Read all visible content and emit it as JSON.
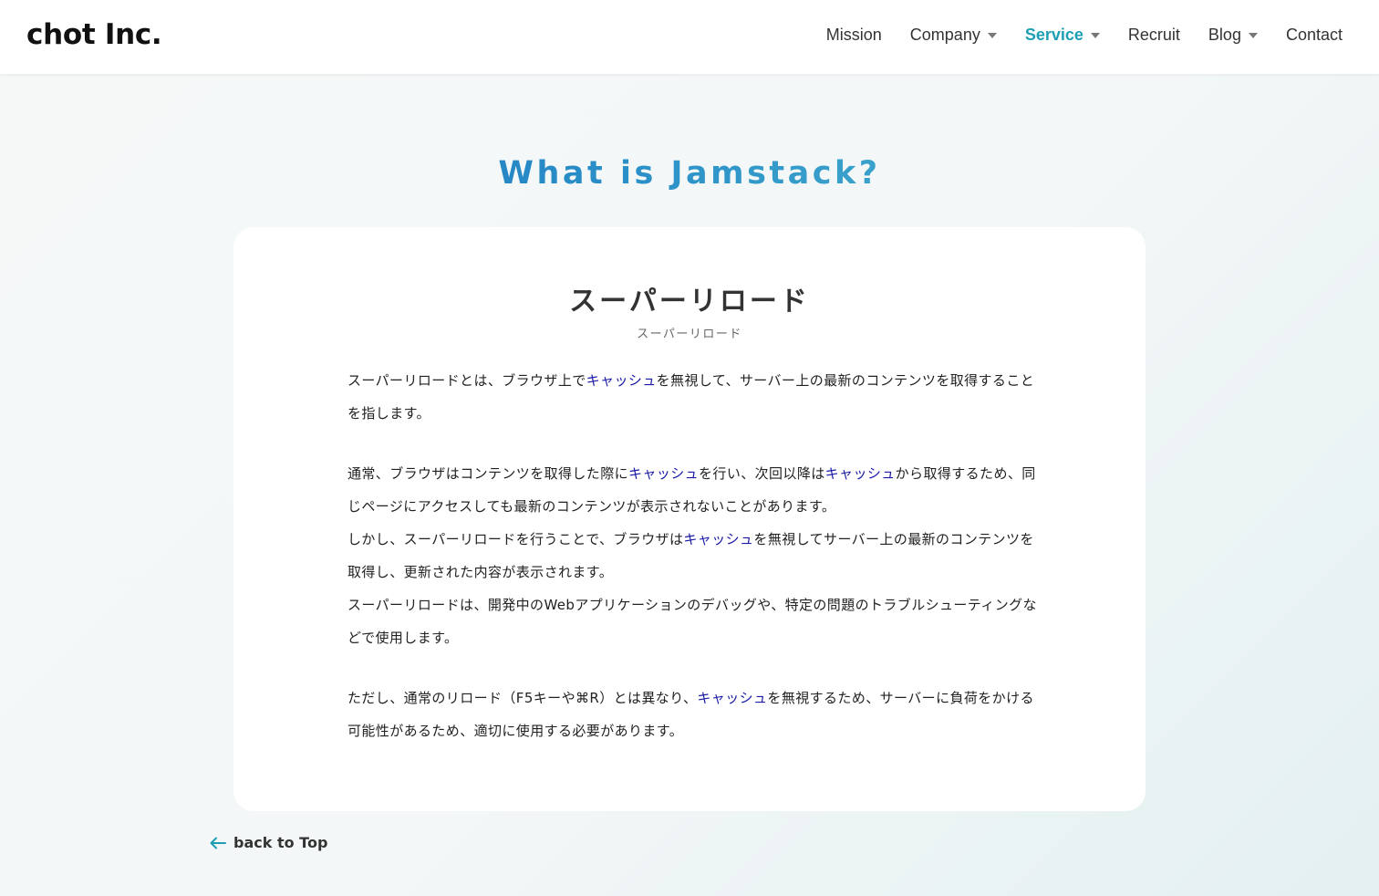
{
  "header": {
    "logo": "chot Inc.",
    "nav": [
      {
        "label": "Mission",
        "dropdown": false
      },
      {
        "label": "Company",
        "dropdown": true
      },
      {
        "label": "Service",
        "dropdown": true,
        "active": true
      },
      {
        "label": "Recruit",
        "dropdown": false
      },
      {
        "label": "Blog",
        "dropdown": true
      },
      {
        "label": "Contact",
        "dropdown": false
      }
    ]
  },
  "section_title": "What is Jamstack?",
  "term": {
    "title": "スーパーリロード",
    "reading": "スーパーリロード"
  },
  "paragraphs": {
    "p1": {
      "a": "スーパーリロードとは、ブラウザ上で",
      "link1": "キャッシュ",
      "b": "を無視して、サーバー上の最新のコンテンツを取得することを指します。"
    },
    "p2": {
      "a": "通常、ブラウザはコンテンツを取得した際に",
      "link1": "キャッシュ",
      "b": "を行い、次回以降は",
      "link2": "キャッシュ",
      "c": "から取得するため、同じページにアクセスしても最新のコンテンツが表示されないことがあります。"
    },
    "p3": {
      "a": "しかし、スーパーリロードを行うことで、ブラウザは",
      "link1": "キャッシュ",
      "b": "を無視してサーバー上の最新のコンテンツを取得し、更新された内容が表示されます。"
    },
    "p4": {
      "a": "スーパーリロードは、開発中のWebアプリケーションのデバッグや、特定の問題のトラブルシューティングなどで使用します。"
    },
    "p5": {
      "a": "ただし、通常のリロード（F5キーや⌘R）とは異なり、",
      "link1": "キャッシュ",
      "b": "を無視するため、サーバーに負荷をかける可能性があるため、適切に使用する必要があります。"
    }
  },
  "back_link": "back to Top",
  "colors": {
    "accent": "#1f9fb3",
    "link": "#1a1aa6",
    "title_gradient_start": "#1668b8",
    "title_gradient_end": "#59c5d3"
  },
  "icons": {
    "back": "arrow-left-icon",
    "dropdown": "caret-down-icon"
  }
}
